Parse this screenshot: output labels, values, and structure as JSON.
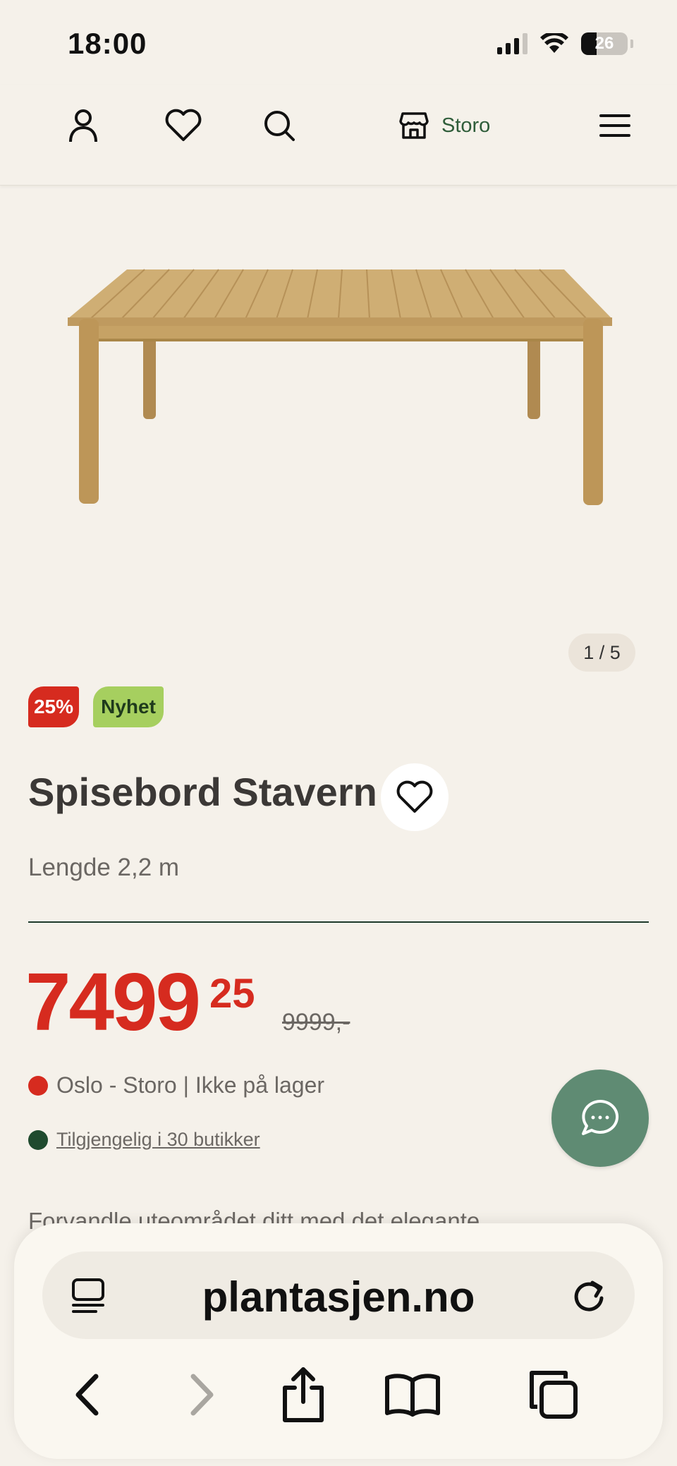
{
  "status_bar": {
    "time": "18:00",
    "battery": "26"
  },
  "header": {
    "store_label": "Storo",
    "icons": [
      "user-icon",
      "heart-icon",
      "search-icon",
      "store-icon",
      "menu-icon"
    ]
  },
  "gallery": {
    "counter": "1 / 5"
  },
  "badges": {
    "discount": "25%",
    "new": "Nyhet"
  },
  "product": {
    "title": "Spisebord Stavern",
    "subtitle": "Lengde 2,2 m",
    "price_main": "7499",
    "price_cents": "25",
    "price_old": "9999,-",
    "stock_local": "Oslo - Storo | Ikke på lager",
    "stock_available": "Tilgjengelig i 30 butikker",
    "description": "Forvandle uteområdet ditt med det elegante"
  },
  "colors": {
    "accent_red": "#d62b1f",
    "accent_green": "#2f5d3a",
    "badge_new": "#a6cf5f",
    "chat_button": "#5f8b73",
    "background": "#f5f1ea"
  },
  "browser": {
    "url": "plantasjen.no",
    "icons": [
      "reader-icon",
      "reload-icon",
      "back-icon",
      "forward-icon",
      "share-icon",
      "bookmarks-icon",
      "tabs-icon"
    ]
  }
}
